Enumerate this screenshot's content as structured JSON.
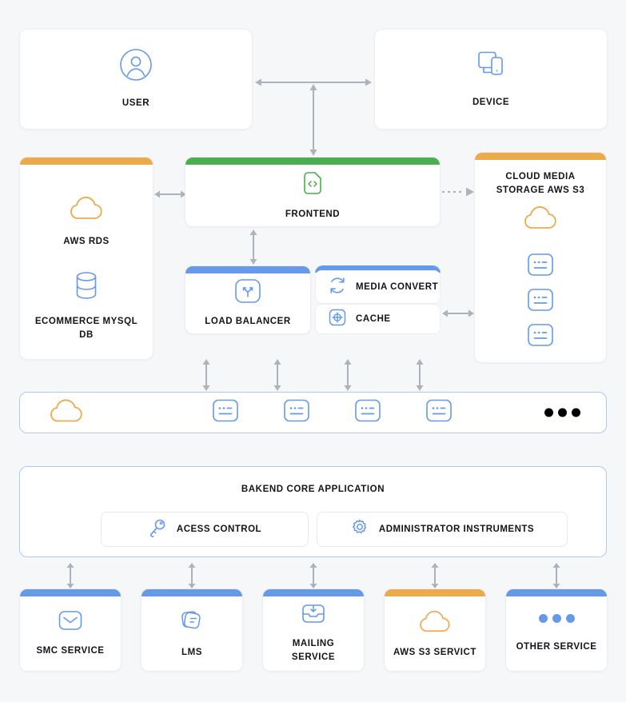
{
  "colors": {
    "background": "#F6F7F9",
    "card": "#FFFFFF",
    "blue": "#6699E8",
    "orange": "#EDAA4B",
    "green": "#4BAE4F",
    "arrow": "#ADB3BA",
    "text": "#12141A"
  },
  "top_row": {
    "user": {
      "label": "USER",
      "icon": "user-circle-icon"
    },
    "device": {
      "label": "DEVICE",
      "icon": "monitor-phone-icon"
    }
  },
  "data_layer": {
    "accent": "#EDAA4B",
    "items": [
      {
        "label": "AWS RDS",
        "icon": "cloud-icon"
      },
      {
        "label": "ECOMMERCE MYSQL DB",
        "icon": "database-icon"
      }
    ]
  },
  "frontend": {
    "label": "FRONTEND",
    "icon": "code-file-icon",
    "accent": "#4BAE4F"
  },
  "media_storage": {
    "label": "CLOUD MEDIA STORAGE AWS S3",
    "accent": "#EDAA4B",
    "cloud_icon": "cloud-icon",
    "servers": [
      "server-icon",
      "server-icon",
      "server-icon"
    ]
  },
  "middle_row": {
    "load_balancer": {
      "label": "LOAD BALANCER",
      "icon": "load-balancer-icon",
      "accent": "#6699E8"
    },
    "media_convert": {
      "label": "MEDIA CONVERT",
      "icon": "sync-icon"
    },
    "cache": {
      "label": "CACHE",
      "icon": "grid-plus-icon"
    }
  },
  "instances_bar": {
    "cloud_icon": "cloud-icon",
    "servers": [
      "server-icon",
      "server-icon",
      "server-icon",
      "server-icon"
    ],
    "more": "ellipsis-icon"
  },
  "backend": {
    "title": "BAKEND CORE APPLICATION",
    "modules": [
      {
        "label": "ACESS CONTROL",
        "icon": "key-icon"
      },
      {
        "label": "ADMINISTRATOR INSTRUMENTS",
        "icon": "gear-icon"
      }
    ]
  },
  "services": [
    {
      "label": "SMC SERVICE",
      "icon": "envelope-icon",
      "accent": "#6699E8"
    },
    {
      "label": "LMS",
      "icon": "cards-icon",
      "accent": "#6699E8"
    },
    {
      "label": "MAILING SERVICE",
      "icon": "inbox-download-icon",
      "accent": "#6699E8"
    },
    {
      "label": "AWS S3 SERVICT",
      "icon": "cloud-icon",
      "accent": "#EDAA4B"
    },
    {
      "label": "OTHER SERVICE",
      "icon": "three-dots-icon",
      "accent": "#6699E8"
    }
  ]
}
